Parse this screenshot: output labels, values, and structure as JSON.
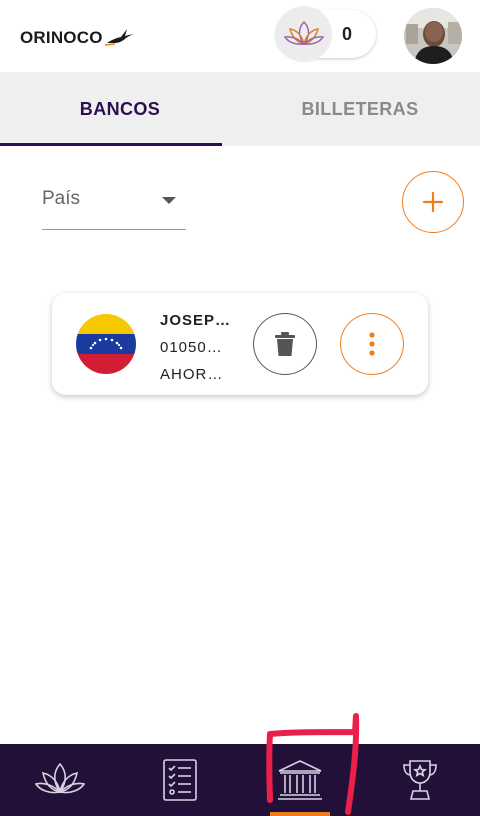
{
  "header": {
    "logo_text": "ORINOCO",
    "points_value": "0"
  },
  "tabs": [
    {
      "label": "BANCOS",
      "active": true
    },
    {
      "label": "BILLETERAS",
      "active": false
    }
  ],
  "filter": {
    "country_label": "País"
  },
  "bank_card": {
    "name": "JOSEP…",
    "account_number": "01050…",
    "account_type": "AHOR…",
    "flag": "venezuela-flag"
  },
  "bottom_nav": {
    "items": [
      {
        "icon": "lotus-icon"
      },
      {
        "icon": "checklist-icon"
      },
      {
        "icon": "bank-icon",
        "active": true
      },
      {
        "icon": "trophy-icon"
      }
    ]
  },
  "colors": {
    "brand_purple": "#2b0f50",
    "nav_bg": "#231038",
    "accent_orange": "#f07d1c"
  }
}
